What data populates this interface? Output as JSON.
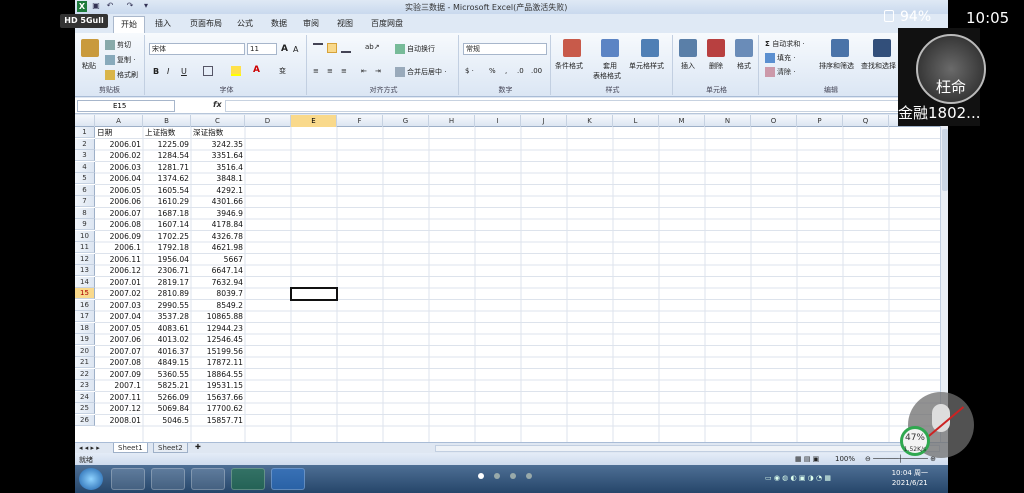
{
  "window": {
    "title": "实验三数据 - Microsoft Excel(产品激活失败)",
    "excel_logo": "X"
  },
  "overlay": {
    "hd_badge": "HD 5Gull",
    "battery": "94%",
    "time": "10:05",
    "avatar_name": "枉命",
    "avatar_class": "金融1802...",
    "speed_badge_top": "47%",
    "speed_badge_bottom": "1.52K/s"
  },
  "tabs": [
    "开始",
    "插入",
    "页面布局",
    "公式",
    "数据",
    "审阅",
    "视图",
    "百度网盘"
  ],
  "ribbon": {
    "clipboard": {
      "paste": "粘贴",
      "cut": "剪切",
      "copy": "复制 ·",
      "format_painter": "格式刷",
      "label": "剪贴板"
    },
    "font": {
      "name": "宋体",
      "size": "11",
      "bold": "B",
      "italic": "I",
      "underline": "U",
      "grow": "A",
      "shrink": "A",
      "wen": "变",
      "label": "字体"
    },
    "alignment": {
      "wrap": "自动换行",
      "merge": "合并后居中 ·",
      "label": "对齐方式"
    },
    "number": {
      "format": "常规",
      "currency": "$ ·",
      "percent": "%",
      "comma": ",",
      "label": "数字"
    },
    "styles": {
      "conditional": "条件格式",
      "table_format_1": "套用",
      "table_format_2": "表格格式",
      "cell_style": "单元格样式",
      "label": "样式"
    },
    "cells": {
      "insert": "插入",
      "delete": "删除",
      "format": "格式",
      "label": "单元格"
    },
    "editing": {
      "autosum": "自动求和 ·",
      "fill": "填充 ·",
      "clear": "清除 ·",
      "sort": "排序和筛选",
      "find": "查找和选择",
      "label": "编辑"
    }
  },
  "formula_bar": {
    "name_box": "E15",
    "fx": "fx",
    "value": ""
  },
  "columns": [
    "A",
    "B",
    "C",
    "D",
    "E",
    "F",
    "G",
    "H",
    "I",
    "J",
    "K",
    "L",
    "M",
    "N",
    "O",
    "P",
    "Q"
  ],
  "active_column": "E",
  "active_row": "15",
  "rows": [
    {
      "n": "1",
      "a": "日期",
      "b": "上证指数",
      "c": "深证指数"
    },
    {
      "n": "2",
      "a": "2006.01",
      "b": "1225.09",
      "c": "3242.35"
    },
    {
      "n": "3",
      "a": "2006.02",
      "b": "1284.54",
      "c": "3351.64"
    },
    {
      "n": "4",
      "a": "2006.03",
      "b": "1281.71",
      "c": "3516.4"
    },
    {
      "n": "5",
      "a": "2006.04",
      "b": "1374.62",
      "c": "3848.1"
    },
    {
      "n": "6",
      "a": "2006.05",
      "b": "1605.54",
      "c": "4292.1"
    },
    {
      "n": "7",
      "a": "2006.06",
      "b": "1610.29",
      "c": "4301.66"
    },
    {
      "n": "8",
      "a": "2006.07",
      "b": "1687.18",
      "c": "3946.9"
    },
    {
      "n": "9",
      "a": "2006.08",
      "b": "1607.14",
      "c": "4178.84"
    },
    {
      "n": "10",
      "a": "2006.09",
      "b": "1702.25",
      "c": "4326.78"
    },
    {
      "n": "11",
      "a": "2006.1",
      "b": "1792.18",
      "c": "4621.98"
    },
    {
      "n": "12",
      "a": "2006.11",
      "b": "1956.04",
      "c": "5667"
    },
    {
      "n": "13",
      "a": "2006.12",
      "b": "2306.71",
      "c": "6647.14"
    },
    {
      "n": "14",
      "a": "2007.01",
      "b": "2819.17",
      "c": "7632.94"
    },
    {
      "n": "15",
      "a": "2007.02",
      "b": "2810.89",
      "c": "8039.7"
    },
    {
      "n": "16",
      "a": "2007.03",
      "b": "2990.55",
      "c": "8549.2"
    },
    {
      "n": "17",
      "a": "2007.04",
      "b": "3537.28",
      "c": "10865.88"
    },
    {
      "n": "18",
      "a": "2007.05",
      "b": "4083.61",
      "c": "12944.23"
    },
    {
      "n": "19",
      "a": "2007.06",
      "b": "4013.02",
      "c": "12546.45"
    },
    {
      "n": "20",
      "a": "2007.07",
      "b": "4016.37",
      "c": "15199.56"
    },
    {
      "n": "21",
      "a": "2007.08",
      "b": "4849.15",
      "c": "17872.11"
    },
    {
      "n": "22",
      "a": "2007.09",
      "b": "5360.55",
      "c": "18864.55"
    },
    {
      "n": "23",
      "a": "2007.1",
      "b": "5825.21",
      "c": "19531.15"
    },
    {
      "n": "24",
      "a": "2007.11",
      "b": "5266.09",
      "c": "15637.66"
    },
    {
      "n": "25",
      "a": "2007.12",
      "b": "5069.84",
      "c": "17700.62"
    },
    {
      "n": "26",
      "a": "2008.01",
      "b": "5046.5",
      "c": "15857.71"
    }
  ],
  "sheets": [
    "Sheet1",
    "Sheet2"
  ],
  "status": {
    "mode": "就绪",
    "zoom": "100%"
  },
  "taskbar": {
    "time": "10:04 周一",
    "date": "2021/6/21"
  },
  "colors": {
    "accent": "#1d7a3c",
    "ribbon": "#dfe7f2",
    "active_header": "#f9d98b"
  }
}
